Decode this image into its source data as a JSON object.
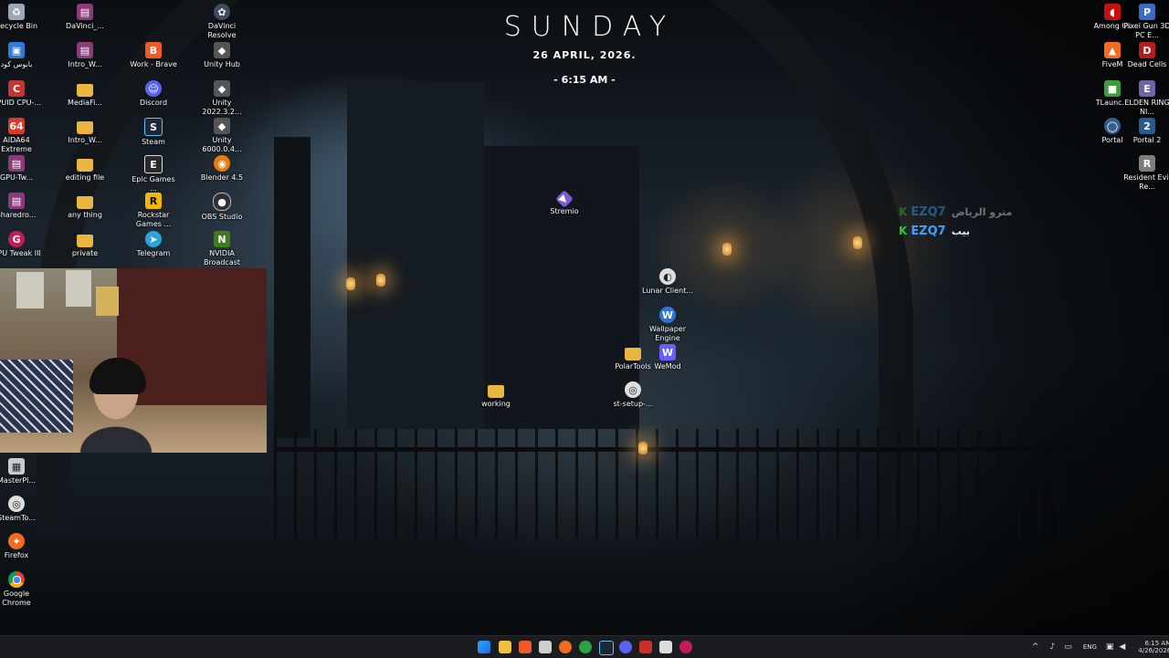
{
  "clock": {
    "day": "SUNDAY",
    "date": "26 APRIL, 2026.",
    "time": "- 6:15 AM -"
  },
  "desktop": {
    "icons": {
      "recycle_bin": "Recycle Bin",
      "babous_code": "بابوس كود",
      "cpuid": "CPUID CPU-...",
      "aida64": "AIDA64 Extreme",
      "gpu_tw": "GPU-Tw...",
      "sharedro": "sharedro...",
      "gpu_tweak": "GPU Tweak III",
      "davinci_short": "DaVinci_...",
      "intro_w1": "Intro_W...",
      "mediafi": "MediaFi...",
      "intro_w2": "Intro_W...",
      "editing_file": "editing file",
      "any_thing": "any thing",
      "private": "private",
      "work_brave": "Work - Brave",
      "discord": "Discord",
      "steam": "Steam",
      "epic": "Epic Games ...",
      "rockstar": "Rockstar Games ...",
      "telegram": "Telegram",
      "davinci_resolve": "DaVinci Resolve",
      "unity_hub": "Unity Hub",
      "unity_2022": "Unity 2022.3.2...",
      "unity_6000": "Unity 6000.0.4...",
      "blender": "Blender 4.5",
      "obs": "OBS Studio",
      "nvidia": "NVIDIA Broadcast",
      "stremio": "Stremio",
      "lunar": "Lunar Client...",
      "wallpaper_engine": "Wallpaper Engine",
      "polartools": "PolarTools",
      "wemod": "WeMod",
      "working": "working",
      "st_setup": "st-setup-...",
      "among_us": "Among Us",
      "pixel_gun": "Pixel Gun 3D PC E...",
      "fivem": "FiveM",
      "dead_cells": "Dead Cells",
      "tlauncher": "TLaunc...",
      "elden_ring": "ELDEN RING NI...",
      "portal": "Portal",
      "portal2": "Portal 2",
      "resident_evil": "Resident Evil Re...",
      "masterpl": "MasterPl...",
      "steamto": "SteamTo...",
      "firefox": "Firefox",
      "chrome": "Google Chrome"
    }
  },
  "notifications": [
    {
      "name": "EZQ7",
      "text": "مترو الرياض"
    },
    {
      "name": "EZQ7",
      "text": "بيب"
    }
  ],
  "tray": {
    "lang": "ENG",
    "time": "6:15 AM",
    "date": "4/26/2026"
  }
}
